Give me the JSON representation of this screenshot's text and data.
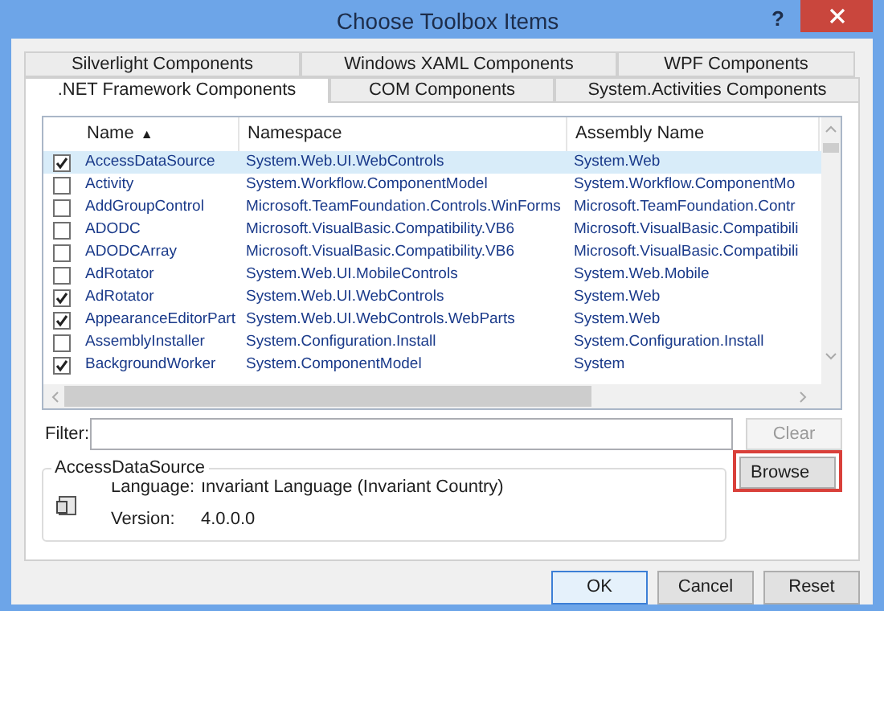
{
  "window": {
    "title": "Choose Toolbox Items",
    "help": "?"
  },
  "tab_rows": [
    [
      {
        "label": "Silverlight Components",
        "selected": false
      },
      {
        "label": "Windows XAML Components",
        "selected": false
      },
      {
        "label": "WPF Components",
        "selected": false
      }
    ],
    [
      {
        "label": ".NET Framework Components",
        "selected": true
      },
      {
        "label": "COM Components",
        "selected": false
      },
      {
        "label": "System.Activities Components",
        "selected": false
      }
    ]
  ],
  "table": {
    "columns": [
      "Name",
      "Namespace",
      "Assembly Name"
    ],
    "sort_indicator": "▲",
    "rows": [
      {
        "checked": true,
        "selected": true,
        "name": "AccessDataSource",
        "namespace": "System.Web.UI.WebControls",
        "assembly": "System.Web"
      },
      {
        "checked": false,
        "selected": false,
        "name": "Activity",
        "namespace": "System.Workflow.ComponentModel",
        "assembly": "System.Workflow.ComponentMo"
      },
      {
        "checked": false,
        "selected": false,
        "name": "AddGroupControl",
        "namespace": "Microsoft.TeamFoundation.Controls.WinForms",
        "assembly": "Microsoft.TeamFoundation.Contr"
      },
      {
        "checked": false,
        "selected": false,
        "name": "ADODC",
        "namespace": "Microsoft.VisualBasic.Compatibility.VB6",
        "assembly": "Microsoft.VisualBasic.Compatibili"
      },
      {
        "checked": false,
        "selected": false,
        "name": "ADODCArray",
        "namespace": "Microsoft.VisualBasic.Compatibility.VB6",
        "assembly": "Microsoft.VisualBasic.Compatibili"
      },
      {
        "checked": false,
        "selected": false,
        "name": "AdRotator",
        "namespace": "System.Web.UI.MobileControls",
        "assembly": "System.Web.Mobile"
      },
      {
        "checked": true,
        "selected": false,
        "name": "AdRotator",
        "namespace": "System.Web.UI.WebControls",
        "assembly": "System.Web"
      },
      {
        "checked": true,
        "selected": false,
        "name": "AppearanceEditorPart",
        "namespace": "System.Web.UI.WebControls.WebParts",
        "assembly": "System.Web"
      },
      {
        "checked": false,
        "selected": false,
        "name": "AssemblyInstaller",
        "namespace": "System.Configuration.Install",
        "assembly": "System.Configuration.Install"
      },
      {
        "checked": true,
        "selected": false,
        "name": "BackgroundWorker",
        "namespace": "System.ComponentModel",
        "assembly": "System"
      }
    ]
  },
  "filter": {
    "label": "Filter:",
    "clear_button": "Clear"
  },
  "details": {
    "title": "AccessDataSource",
    "language_label": "Language:",
    "language": "Invariant Language (Invariant Country)",
    "version_label": "Version:",
    "version": "4.0.0.0"
  },
  "browse_button": {
    "label": "Browse",
    "highlighted": true
  },
  "buttons": [
    "OK",
    "Cancel",
    "Reset"
  ]
}
